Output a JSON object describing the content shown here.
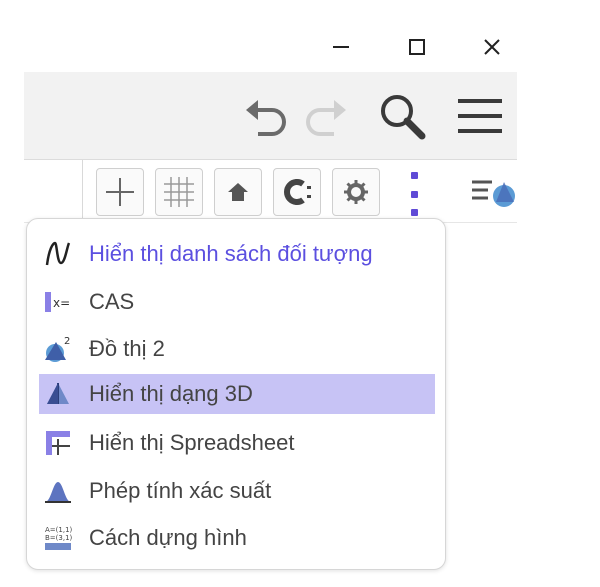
{
  "window": {
    "minimize_glyph": "—",
    "maximize_glyph": "☐",
    "close_glyph": "✕"
  },
  "toolbar": {
    "icons": [
      "undo-icon",
      "redo-icon",
      "search-icon",
      "menu-icon"
    ]
  },
  "stylebar": {
    "buttons": [
      "axes-icon",
      "grid-icon",
      "home-icon",
      "c-icon",
      "gear-icon",
      "more-vert-icon",
      "view-menu-icon"
    ]
  },
  "menu": {
    "items": [
      {
        "label": "Hiển thị danh sách đối tượng",
        "icon": "algebra-icon",
        "active": true,
        "highlighted": false
      },
      {
        "label": "CAS",
        "icon": "cas-icon",
        "active": false,
        "highlighted": false
      },
      {
        "label": "Đồ thị 2",
        "icon": "graphics2-icon",
        "active": false,
        "highlighted": false
      },
      {
        "label": "Hiển thị dạng 3D",
        "icon": "3d-icon",
        "active": false,
        "highlighted": true
      },
      {
        "label": "Hiển thị Spreadsheet",
        "icon": "spreadsheet-icon",
        "active": false,
        "highlighted": false
      },
      {
        "label": "Phép tính xác suất",
        "icon": "probability-icon",
        "active": false,
        "highlighted": false
      },
      {
        "label": "Cách dựng hình",
        "icon": "construction-protocol-icon",
        "active": false,
        "highlighted": false
      }
    ]
  },
  "colors": {
    "accent": "#5b4fe0",
    "highlight": "#c7c3f5",
    "toolbar_bg": "#f2f2f2"
  }
}
